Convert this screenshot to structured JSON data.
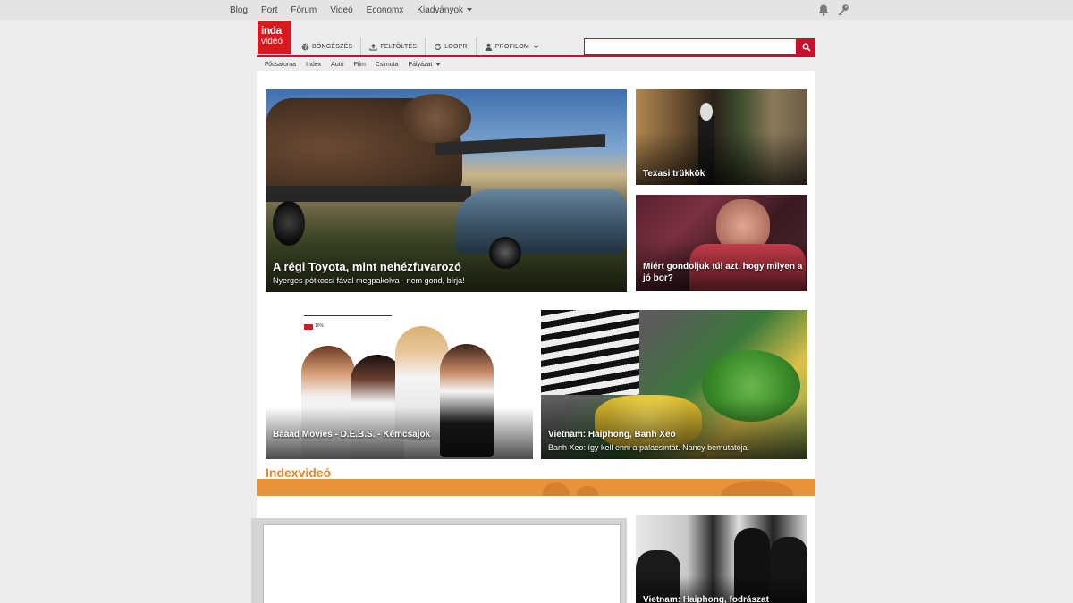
{
  "topnav": {
    "items": [
      "Blog",
      "Port",
      "Fórum",
      "Videó",
      "Economx",
      "Kiadványok"
    ]
  },
  "icons": {
    "notifications": "bell-icon",
    "login": "key-icon"
  },
  "header": {
    "logo_line1": "inda",
    "logo_line2": "videó",
    "nav": [
      {
        "label": "BÖNGÉSZÉS",
        "icon": "globe-icon"
      },
      {
        "label": "FELTÖLTÉS",
        "icon": "upload-icon"
      },
      {
        "label": "LOOPR",
        "icon": "loop-icon"
      },
      {
        "label": "PROFILOM",
        "icon": "user-icon"
      }
    ],
    "search_placeholder": ""
  },
  "subnav": {
    "items": [
      "Főcsatorna",
      "Index",
      "Autó",
      "Film",
      "Csimota",
      "Pályázat"
    ]
  },
  "cards": {
    "main": {
      "title": "A régi Toyota, mint nehézfuvarozó",
      "subtitle": "Nyerges pótkocsi fával megpakolva - nem gond, bírja!"
    },
    "texas": {
      "title": "Texasi trükkök"
    },
    "wine": {
      "title": "Miért gondoljuk túl azt, hogy milyen a jó bor?"
    },
    "poster": {
      "title": "Baaad Movies - D.E.B.S. - Kémcsajok",
      "chart_label": "10%"
    },
    "food": {
      "title": "Vietnam: Haiphong, Banh Xeo",
      "subtitle": "Banh Xeo: így kell enni a palacsintát. Nancy bemutatója."
    },
    "barber": {
      "title": "Vietnam: Haiphong, fodrászat"
    }
  },
  "section": {
    "title": "Indexvideó"
  },
  "colors": {
    "brand_red": "#c8102e",
    "logo_red": "#d71920",
    "section_orange": "#e8923a",
    "section_title": "#e38a2e"
  }
}
